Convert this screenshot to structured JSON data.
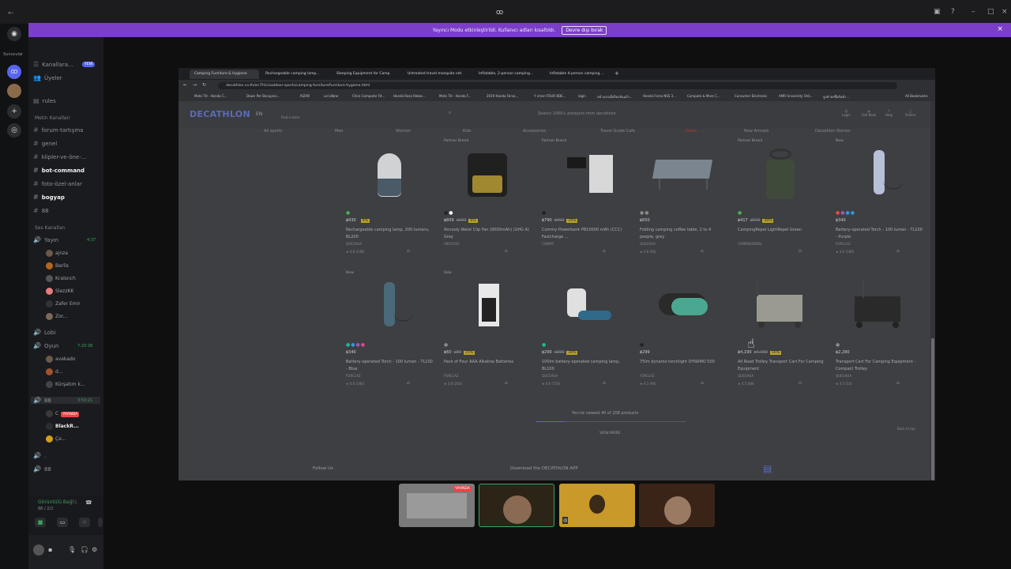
{
  "window": {
    "title": "ꝏ",
    "back": "←"
  },
  "banner": {
    "text": "Yayıncı Modu etkinleştirildi. Kullanıcı adları kısaltıldı.",
    "button": "Devre dışı bırak",
    "close": "×"
  },
  "rail": {
    "label": "Sunucular"
  },
  "sidebar": {
    "items": [
      {
        "label": "Kanallara...",
        "badge": "YENİ"
      },
      {
        "label": "Üyeler"
      },
      {
        "label": "rules"
      }
    ],
    "text_category": "Metin Kanalları",
    "text_channels": [
      "forum-tartışma",
      "genel",
      "klipler-ve-öne-...",
      "bot-command",
      "foto-özel-anlar",
      "bogyap",
      "88"
    ],
    "voice_category": "Ses Kanalları",
    "voice_channels": [
      {
        "name": "Yayın",
        "time": "4:37",
        "users": [
          "ajnza",
          "Berlis",
          "Kralsnch",
          "SlezzKK",
          "Zafer Emir",
          "Zor..."
        ]
      },
      {
        "name": "Lobi"
      },
      {
        "name": "Oyun",
        "time": "7:20:38",
        "users": [
          "avekado",
          "d...",
          "Kürşatım k..."
        ]
      },
      {
        "name": "88",
        "time": "3:53:21",
        "users": [
          "C",
          "BlackR...",
          "Çe..."
        ],
        "live_tag": "YAYINDA"
      },
      {
        "name": "."
      },
      {
        "name": "88"
      }
    ],
    "voice_panel": {
      "status": "Görüntülü Bağl",
      "sub": "88 / 2/2"
    }
  },
  "browser": {
    "tabs": [
      "Camping Furniture & Hygiene",
      "Rechargeable camping lamp...",
      "Sleeping Equipment for Camp",
      "Untreated travel mosquito net",
      "Inflatable, 2-person camping...",
      "Inflatable 4-person camping ..."
    ],
    "url": "decathlon.co.th/en-TH/c/outdoor-sports/camping-furniture/furniture-hygiene.html",
    "bookmarks": [
      "Moto TH - Honda C...",
      "Down Per Bocupnix...",
      "RIZAR",
      "un'allbne",
      "Chiro Computer Fit...",
      "Honda Rosa Rebes...",
      "Moto TH - Honda F...",
      "2019 Honda Fersa...",
      "Y nmsn-TOUR 8DE...",
      "login",
      "หน้าแรกเมื่อล็อกอินแล้ว...",
      "Honda Forza NSS 3...",
      "Compute & More C...",
      "Consumer Electronic",
      "AMR University Onli...",
      "ลูกค้าส่งซื้อสินค้า...",
      "All Bookmarks"
    ]
  },
  "site": {
    "logo": "DECATHLON",
    "lang": "EN",
    "store": "Find a store",
    "search_placeholder": "Search 1000+ products from decathlon",
    "header_icons": [
      "Login",
      "Sell Back",
      "Help",
      "Orders"
    ],
    "nav": [
      "All sports",
      "Men",
      "Women",
      "Kids",
      "Accessories",
      "Travel Guide Cafe",
      "Deals",
      "New Arrivals",
      "Decathlon Stories"
    ],
    "products": [
      {
        "tag": "",
        "dots": [
          "#4caf50"
        ],
        "price": "฿930",
        "old": "",
        "discount": "4%",
        "name": "Rechargeable camping lamp, 200 lumens, BL200",
        "brand": "QUECHUA",
        "rating": "★ 4.8 (349)",
        "img": "lamp"
      },
      {
        "tag": "Partner Brand",
        "dots": [
          "#222",
          "#fff"
        ],
        "price": "฿809",
        "old": "฿999",
        "discount": "6%",
        "name": "Aircooly Waist Clip Fan (9000mAh) (UHG A) Grey",
        "brand": "AIRCOOLY",
        "rating": "",
        "img": "fan"
      },
      {
        "tag": "Partner Brand",
        "dots": [
          "#222"
        ],
        "price": "฿790",
        "old": "฿990",
        "discount": "20%",
        "name": "Commy Powerbank PB10000 mAh (CCC) Fastcharge ...",
        "brand": "COMMY",
        "rating": "",
        "img": "powerbank"
      },
      {
        "tag": "",
        "dots": [
          "#888",
          "#888"
        ],
        "price": "฿650",
        "old": "",
        "discount": "",
        "name": "Folding camping coffee table, 2 to 4 people, grey",
        "brand": "QUECHUA",
        "rating": "★ 4.8 (56)",
        "img": "table"
      },
      {
        "tag": "Partner Brand",
        "dots": [
          "#4caf50"
        ],
        "price": "฿417",
        "old": "฿599",
        "discount": "30%",
        "name": "CampingRepel LightRepel Green",
        "brand": "CAMPINGREPEL",
        "rating": "",
        "img": "repel"
      },
      {
        "tag": "New",
        "dots": [
          "#e74c3c",
          "#9b59b6",
          "#3498db",
          "#3498db"
        ],
        "price": "฿340",
        "old": "",
        "discount": "",
        "name": "Battery-operated Torch - 100 lumen - TL100 - Purple",
        "brand": "FORCLAZ",
        "rating": "★ 4.6 (180)",
        "img": "torch"
      },
      {
        "tag": "New",
        "dots": [
          "#1abc9c",
          "#3498db",
          "#9b59b6",
          "#e84393"
        ],
        "price": "฿340",
        "old": "",
        "discount": "",
        "name": "Battery-operated Torch - 100 lumen - TL100 - Blue",
        "brand": "FORCLAZ",
        "rating": "★ 4.6 (180)",
        "img": "torch2"
      },
      {
        "tag": "Sale",
        "dots": [
          "#888"
        ],
        "price": "฿60",
        "old": "฿80",
        "discount": "25%",
        "name": "Pack of Four AAA Alkaline Batteries",
        "brand": "FORCLAZ",
        "rating": "★ 4.8 (203)",
        "img": "batteries"
      },
      {
        "tag": "",
        "dots": [
          "#1abc9c"
        ],
        "price": "฿290",
        "old": "฿390",
        "discount": "26%",
        "name": "100lm battery-operated camping lamp, BL100",
        "brand": "QUECHUA",
        "rating": "★ 4.6 (754)",
        "img": "lamp2"
      },
      {
        "tag": "",
        "dots": [
          "#222"
        ],
        "price": "฿299",
        "old": "",
        "discount": "",
        "name": "75lm dynamo torchlight DYNAMO 500",
        "brand": "FORCLAZ",
        "rating": "★ 4.3 (96)",
        "img": "dynamo"
      },
      {
        "tag": "",
        "dots": [],
        "price": "฿4,190",
        "old": "฿4,990",
        "discount": "16%",
        "name": "All Road Trolley Transport Cart For Camping Equipment",
        "brand": "QUECHUA",
        "rating": "★ 4.5 (88)",
        "img": "trolley"
      },
      {
        "tag": "",
        "dots": [
          "#888"
        ],
        "price": "฿2,290",
        "old": "",
        "discount": "",
        "name": "Transport Cart For Camping Equipment - Compact Trolley",
        "brand": "QUECHUA",
        "rating": "★ 4.3 (14)",
        "img": "trolley2"
      }
    ],
    "viewed": "You've viewed 40 of 208 products",
    "viewed_fraction": 0.19,
    "view_more": "VIEW MORE",
    "back_to_top": "Back to top",
    "follow": "Follow Us",
    "download": "Download the DECATHLON APP"
  },
  "streams": {
    "live_label": "YAYINDA"
  }
}
